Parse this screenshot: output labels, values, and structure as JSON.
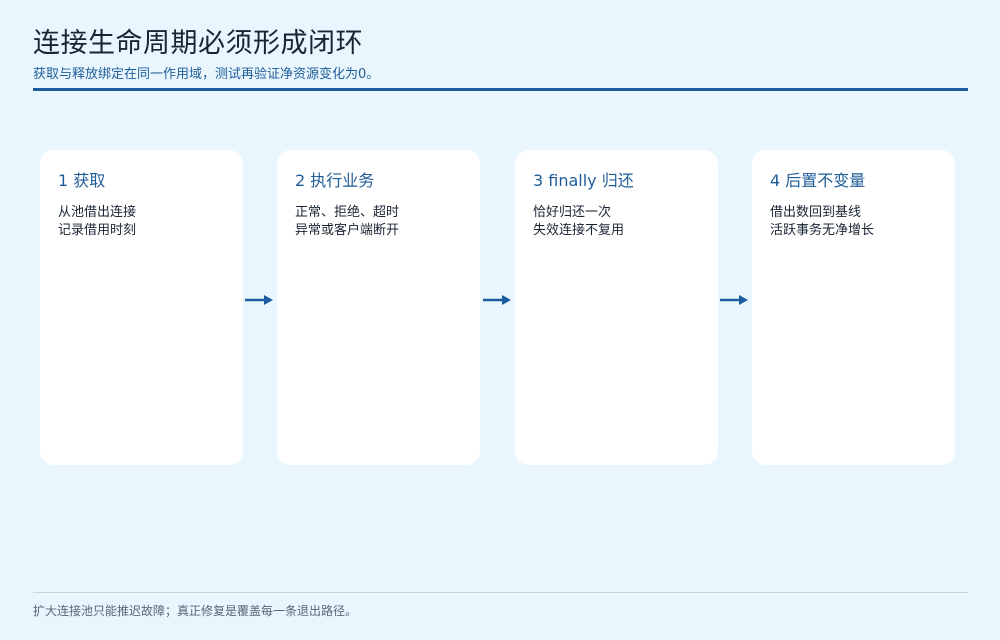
{
  "header": {
    "title": "连接生命周期必须形成闭环",
    "subtitle": "获取与释放绑定在同一作用域，测试再验证净资源变化为0。"
  },
  "steps": [
    {
      "title": "1 获取",
      "lines": [
        "从池借出连接",
        "记录借用时刻"
      ]
    },
    {
      "title": "2 执行业务",
      "lines": [
        "正常、拒绝、超时",
        "异常或客户端断开"
      ]
    },
    {
      "title": "3 finally 归还",
      "lines": [
        "恰好归还一次",
        "失效连接不复用"
      ]
    },
    {
      "title": "4 后置不变量",
      "lines": [
        "借出数回到基线",
        "活跃事务无净增长"
      ]
    }
  ],
  "footer": {
    "note": "扩大连接池只能推迟故障；真正修复是覆盖每一条退出路径。"
  },
  "colors": {
    "accent": "#1c5da0",
    "background": "#eaf6fe",
    "card": "#ffffff"
  }
}
